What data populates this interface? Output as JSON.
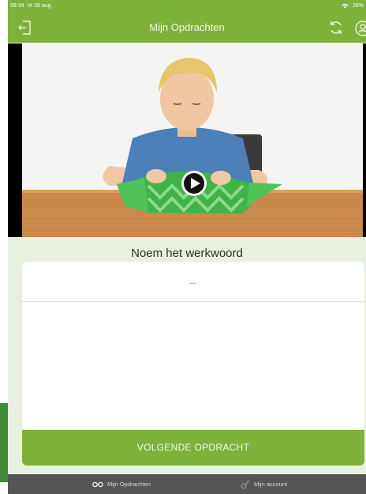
{
  "status_bar": {
    "time": "08:34",
    "date": "Vr 28 aug.",
    "battery": "26%",
    "wifi_icon": "wifi-icon"
  },
  "nav": {
    "title": "Mijn Opdrachten",
    "left_icon": "exit-icon",
    "right_icons": [
      "refresh-icon",
      "profile-icon"
    ]
  },
  "video": {
    "play_icon": "play-icon",
    "description": "Jongen pakt een cadeau in groen papier uit"
  },
  "question": {
    "prompt": "Noem het werkwoord",
    "answer_placeholder": "..."
  },
  "actions": {
    "next_label": "VOLGENDE OPDRACHT"
  },
  "tabbar": {
    "items": [
      {
        "label": "Mijn Opdrachten",
        "icon": "glasses-icon"
      },
      {
        "label": "Mijn account",
        "icon": "guitar-icon"
      }
    ]
  },
  "colors": {
    "brand_green": "#7db33b",
    "content_bg": "#e8f0df",
    "tabbar_bg": "#555555"
  }
}
